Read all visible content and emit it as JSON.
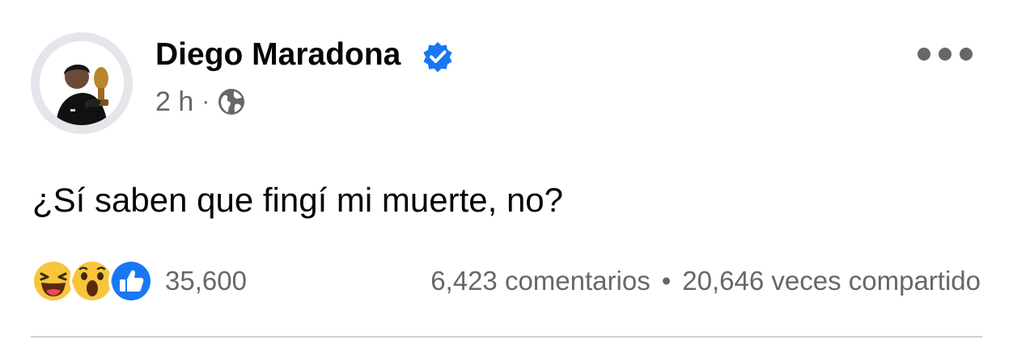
{
  "post": {
    "author": "Diego Maradona",
    "time": "2 h",
    "separator": "·",
    "text": "¿Sí saben que fingí mi muerte, no?"
  },
  "reactions": {
    "types": [
      "haha",
      "wow",
      "like"
    ],
    "count": "35,600"
  },
  "stats": {
    "comments": "6,423 comentarios",
    "bullet": "•",
    "shares": "20,646 veces compartido"
  },
  "icons": {
    "verified": "verified-badge-icon",
    "audience": "globe-icon",
    "more": "more-options-icon"
  },
  "colors": {
    "text": "#050505",
    "secondary": "#65676b",
    "verified": "#1877f2",
    "like": "#1877f2",
    "emoji": "#f7c53c"
  }
}
